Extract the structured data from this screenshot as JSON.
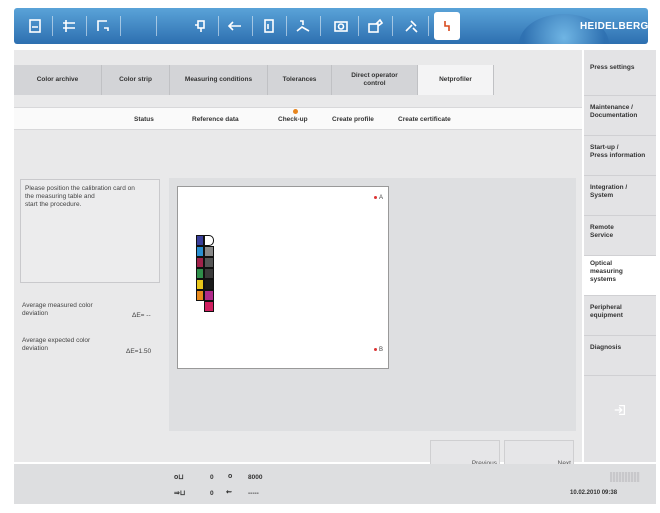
{
  "brand": "HEIDELBERG",
  "colors": {
    "accent": "#2d6fb0",
    "progress": "#e8851d",
    "highlight": "#d84a1c"
  },
  "toolbar": {
    "icons": [
      "job-icon",
      "queue-icon",
      "press-icon",
      "feed-icon",
      "settings-icon",
      "print-unit-icon",
      "delivery-icon",
      "camera-icon",
      "imaging-icon",
      "tools-icon",
      "measure-icon"
    ],
    "selected": "measure-icon"
  },
  "tabs": [
    {
      "label": "Color archive"
    },
    {
      "label": "Color strip"
    },
    {
      "label": "Measuring conditions"
    },
    {
      "label": "Tolerances"
    },
    {
      "label": "Direct operator control"
    },
    {
      "label": "Netprofiler",
      "active": true
    }
  ],
  "subtabs": [
    {
      "label": "Status"
    },
    {
      "label": "Reference data"
    },
    {
      "label": "Check-up",
      "active": true
    },
    {
      "label": "Create profile"
    },
    {
      "label": "Create certificate"
    }
  ],
  "instruction": "Please position the calibration card on\nthe measuring table and\nstart the procedure.",
  "deviation": {
    "measured_label": "Average measured color\ndeviation",
    "measured_value": "ΔE= --",
    "expected_label": "Average expected color\ndeviation",
    "expected_value": "ΔE=1.50"
  },
  "card": {
    "mark_a": "A",
    "mark_b": "B",
    "patches_left": [
      "#3a3f9a",
      "#2a8fd0",
      "#a0224a",
      "#2f8f4a",
      "#e8c61a",
      "#e88a1d"
    ],
    "patches_right": [
      "#ffffff",
      "#888888",
      "#555555",
      "#3a3a3a",
      "#1a1a1a",
      "#b02a8a",
      "#d02060"
    ]
  },
  "nav": {
    "previous": "Previous",
    "next": "Next"
  },
  "sidebar": {
    "items": [
      {
        "label": "Press settings"
      },
      {
        "label": "Maintenance /\nDocumentation"
      },
      {
        "label": "Start-up /\nPress information"
      },
      {
        "label": "Integration /\nSystem"
      },
      {
        "label": "Remote\nService"
      },
      {
        "label": "Optical\nmeasuring\nsystems",
        "active": true
      },
      {
        "label": "Peripheral\nequipment"
      },
      {
        "label": "Diagnosis"
      }
    ]
  },
  "status": {
    "counter1": "0",
    "counter2": "0",
    "speed": "8000",
    "counter3": "0",
    "speed2": "-----",
    "datetime": "10.02.2010  09:38"
  }
}
